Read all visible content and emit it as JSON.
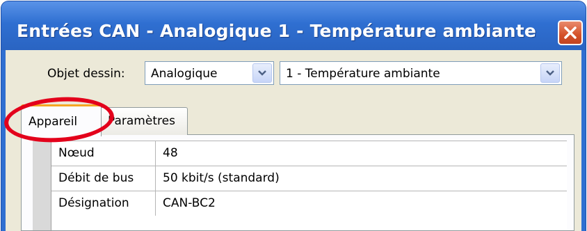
{
  "window": {
    "title": "Entrées CAN - Analogique 1 - Température ambiante",
    "close_icon": "close-icon"
  },
  "toolbar": {
    "object_label": "Objet dessin:",
    "object_type": {
      "selected": "Analogique"
    },
    "object_item": {
      "selected": "1 - Température ambiante"
    }
  },
  "tabs": [
    {
      "label": "Appareil",
      "active": true
    },
    {
      "label": "Paramètres",
      "active": false
    }
  ],
  "device_properties": [
    {
      "key": "Nœud",
      "value": "48"
    },
    {
      "key": "Débit de bus",
      "value": "50 kbit/s (standard)"
    },
    {
      "key": "Désignation",
      "value": "CAN-BC2"
    }
  ],
  "colors": {
    "titlebar": "#2f6fd1",
    "annotation_ring": "#e3001b",
    "active_tab_accent": "#f5a623"
  }
}
